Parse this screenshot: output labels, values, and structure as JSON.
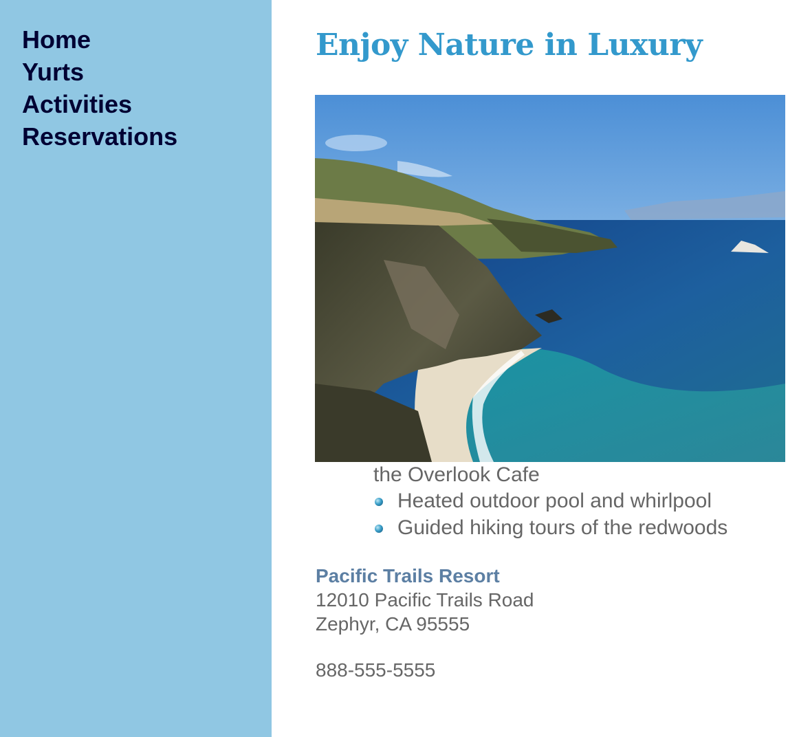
{
  "nav": {
    "items": [
      {
        "label": "Home"
      },
      {
        "label": "Yurts"
      },
      {
        "label": "Activities"
      },
      {
        "label": "Reservations"
      }
    ]
  },
  "main": {
    "title": "Enjoy Nature in Luxury",
    "caption": "the Overlook Cafe",
    "features": [
      "Heated outdoor pool and whirlpool",
      "Guided hiking tours of the redwoods"
    ],
    "contact": {
      "name": "Pacific Trails Resort",
      "street": "12010 Pacific Trails Road",
      "city": "Zephyr, CA 95555",
      "phone": "888-555-5555"
    }
  },
  "colors": {
    "sidebar": "#90c7e3",
    "nav_text": "#000033",
    "title": "#3399cc",
    "resort_name": "#5c7fa3",
    "body_text": "#666666"
  }
}
